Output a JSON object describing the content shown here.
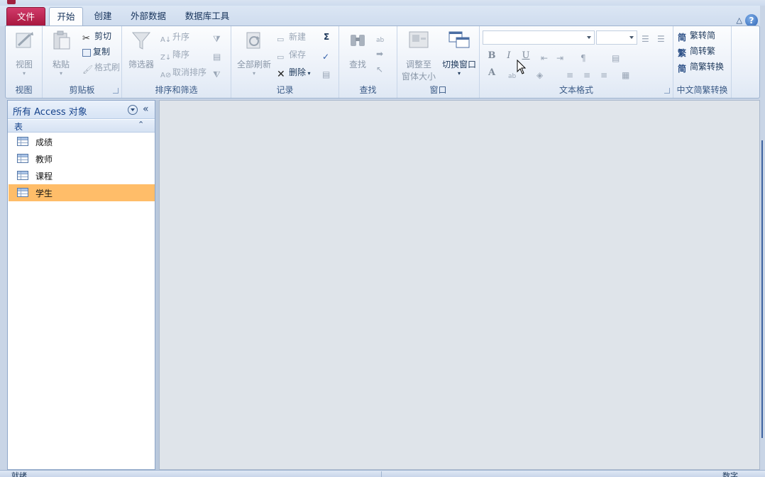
{
  "tabs": {
    "file": "文件",
    "home": "开始",
    "create": "创建",
    "external_data": "外部数据",
    "database_tools": "数据库工具"
  },
  "ribbon": {
    "views": {
      "view_label": "视图",
      "group_label": "视图"
    },
    "clipboard": {
      "paste_label": "粘贴",
      "cut_label": "剪切",
      "copy_label": "复制",
      "format_painter_label": "格式刷",
      "group_label": "剪贴板"
    },
    "sort_filter": {
      "filter_label": "筛选器",
      "ascending_label": "升序",
      "descending_label": "降序",
      "remove_sort_label": "取消排序",
      "group_label": "排序和筛选"
    },
    "records": {
      "refresh_all_label": "全部刷新",
      "new_label": "新建",
      "save_label": "保存",
      "delete_label": "删除",
      "totals_symbol": "Σ",
      "group_label": "记录"
    },
    "find": {
      "find_label": "查找",
      "group_label": "查找"
    },
    "window": {
      "size_to_fit_line1": "调整至",
      "size_to_fit_line2": "窗体大小",
      "switch_windows_label": "切换窗口",
      "group_label": "窗口"
    },
    "text_formatting": {
      "bold": "B",
      "italic": "I",
      "underline": "U",
      "font_color": "A",
      "group_label": "文本格式"
    },
    "chinese_conversion": {
      "trad_to_simp": "繁转简",
      "simp_to_trad": "简转繁",
      "conversion": "简繁转换",
      "group_label": "中文简繁转换"
    }
  },
  "nav_pane": {
    "title": "所有 Access 对象",
    "shutter_icon": "«",
    "group_header": "表",
    "group_collapse_icon": "⌃",
    "items": [
      {
        "label": "成绩"
      },
      {
        "label": "教师"
      },
      {
        "label": "课程"
      },
      {
        "label": "学生"
      }
    ],
    "selected_index": 3
  },
  "statusbar": {
    "left": "就绪",
    "right": "数字"
  },
  "colors": {
    "file_tab": "#b2194a",
    "selected_item": "#ffbd69",
    "ribbon_bg": "#eef3fa",
    "workspace_bg": "#dfe4ea"
  },
  "help": {
    "icon": "?",
    "collapse": "△"
  }
}
